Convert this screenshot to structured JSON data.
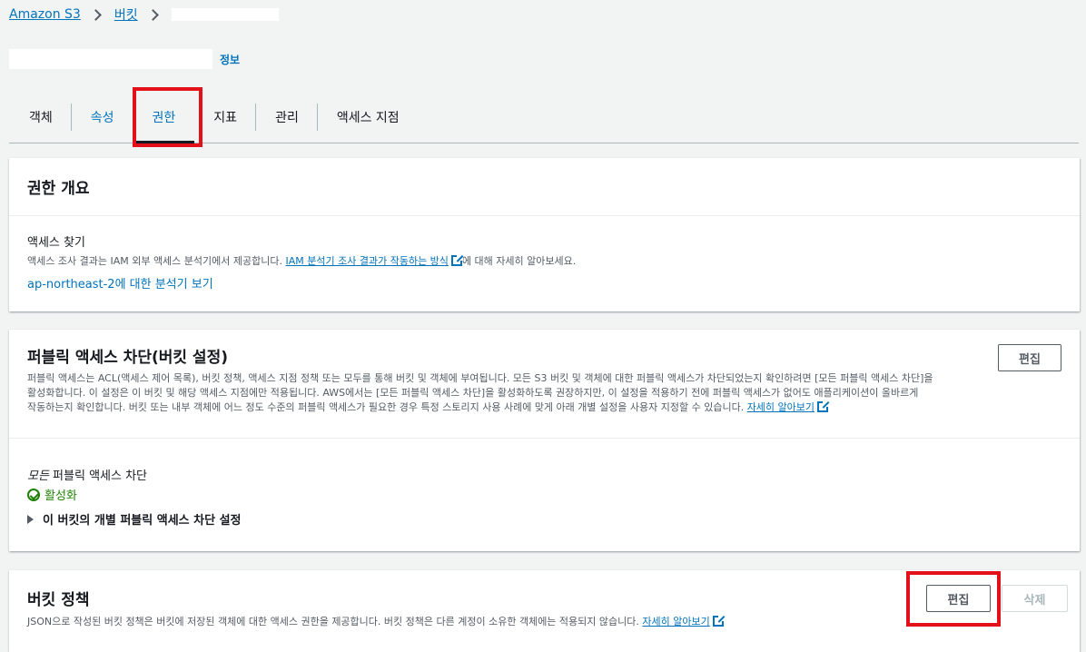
{
  "breadcrumb": {
    "items": [
      "Amazon S3",
      "버킷"
    ]
  },
  "title": {
    "info": "정보"
  },
  "tabs": [
    "객체",
    "속성",
    "권한",
    "지표",
    "관리",
    "액세스 지점"
  ],
  "access_overview": {
    "title": "권한 개요",
    "subtitle": "액세스 찾기",
    "desc_pre": "액세스 조사 결과는 IAM 외부 액세스 분석기에서 제공합니다.",
    "desc_link": "IAM 분석기 조사 결과가 작동하는 방식",
    "desc_post": "에 대해 자세히 알아보세요.",
    "analyzer_link": "ap-northeast-2에 대한 분석기 보기"
  },
  "block_public": {
    "title": "퍼블릭 액세스 차단(버킷 설정)",
    "edit_label": "편집",
    "desc_line1": "퍼블릭 액세스는 ACL(액세스 제어 목록), 버킷 정책, 액세스 지점 정책 또는 모두를 통해 버킷 및 객체에 부여됩니다. 모든 S3 버킷 및 객체에 대한 퍼블릭 액세스가 차단되었는지 확인하려면 [모든 퍼블릭 액세스 차단]을",
    "desc_line2": "활성화합니다. 이 설정은 이 버킷 및 해당 액세스 지점에만 적용됩니다. AWS에서는 [모든 퍼블릭 액세스 차단]을 활성화하도록 권장하지만, 이 설정을 적용하기 전에 퍼블릭 액세스가 없어도 애플리케이션이 올바르게",
    "desc_line3": "작동하는지 확인합니다. 버킷 또는 내부 객체에 어느 정도 수준의 퍼블릭 액세스가 필요한 경우 특정 스토리지 사용 사례에 맞게 아래 개별 설정을 사용자 지정할 수 있습니다.",
    "learn_more": "자세히 알아보기",
    "all_label_em": "모든",
    "all_label_rest": " 퍼블릭 액세스 차단",
    "status": "활성화",
    "expand_label": "이 버킷의 개별 퍼블릭 액세스 차단 설정"
  },
  "bucket_policy": {
    "title": "버킷 정책",
    "edit_label": "편집",
    "delete_label": "삭제",
    "desc": "JSON으로 작성된 버킷 정책은 버킷에 저장된 객체에 대한 액세스 권한을 제공합니다. 버킷 정책은 다른 계정이 소유한 객체에는 적용되지 않습니다.",
    "learn_more": "자세히 알아보기"
  },
  "colors": {
    "accent": "#0073bb",
    "success": "#1d8102",
    "highlight": "#e3101a"
  }
}
